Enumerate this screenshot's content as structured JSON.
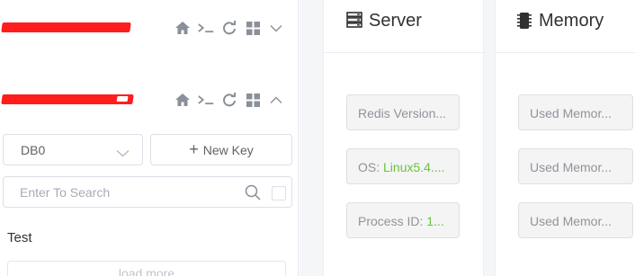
{
  "connections": [
    {
      "state": "collapsed"
    },
    {
      "state": "expanded"
    }
  ],
  "toolbar_icons": [
    "home-icon",
    "terminal-icon",
    "refresh-icon",
    "grid-icon"
  ],
  "db_select": {
    "value": "DB0"
  },
  "new_key_button": {
    "label": "New Key"
  },
  "search": {
    "placeholder": "Enter To Search"
  },
  "keys": [
    "Test"
  ],
  "load_more": {
    "label": "load more"
  },
  "server_panel": {
    "title": "Server",
    "items": [
      {
        "label": "Redis Version...",
        "value": ""
      },
      {
        "label": "OS: ",
        "value": "Linux5.4...."
      },
      {
        "label": "Process ID: ",
        "value": "1..."
      }
    ]
  },
  "memory_panel": {
    "title": "Memory",
    "items": [
      {
        "label": "Used Memor..."
      },
      {
        "label": "Used Memor..."
      },
      {
        "label": "Used Memor..."
      }
    ]
  },
  "colors": {
    "redaction": "#ff1d1d",
    "value_green": "#67c23a",
    "border": "#dcdfe6"
  }
}
